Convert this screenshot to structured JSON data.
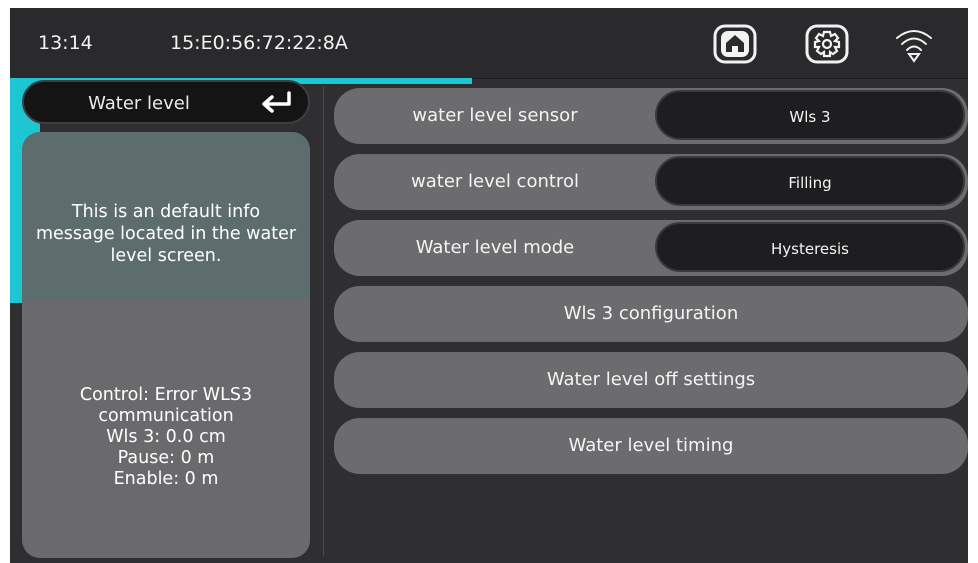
{
  "topbar": {
    "time": "13:14",
    "mac": "15:E0:56:72:22:8A",
    "icons": [
      "home-icon",
      "gear-icon",
      "wifi-icon"
    ]
  },
  "colors": {
    "accent": "#1ec6d3",
    "background": "#2f2f31",
    "row": "#6c6c6e",
    "value_pill": "#1e1e20"
  },
  "left": {
    "title": "Water level",
    "back_icon": "return-arrow-icon",
    "info_message": "This is an default info message located in the water level screen.",
    "status_lines": [
      "Control: Error WLS3",
      "communication",
      "Wls 3: 0.0 cm",
      "Pause: 0 m",
      "Enable: 0 m"
    ]
  },
  "settings": [
    {
      "label": "water level sensor",
      "value": "Wls 3"
    },
    {
      "label": "water level control",
      "value": "Filling"
    },
    {
      "label": "Water level mode",
      "value": "Hysteresis"
    },
    {
      "label": "Wls 3 configuration"
    },
    {
      "label": "Water level off settings"
    },
    {
      "label": "Water level timing"
    }
  ]
}
